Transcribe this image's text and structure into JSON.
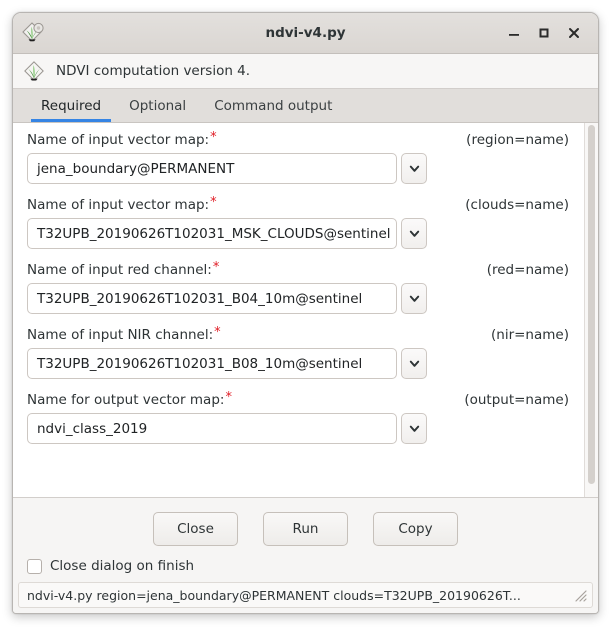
{
  "window": {
    "title": "ndvi-v4.py",
    "icon": "grass-gis-icon",
    "controls": {
      "minimize": "minimize-icon",
      "maximize": "maximize-icon",
      "close": "close-icon"
    }
  },
  "description": {
    "icon": "grass-gis-icon",
    "text": "NDVI computation version 4."
  },
  "tabs": [
    {
      "label": "Required",
      "active": true
    },
    {
      "label": "Optional",
      "active": false
    },
    {
      "label": "Command output",
      "active": false
    }
  ],
  "fields": [
    {
      "label": "Name of input vector map:",
      "required": "*",
      "key": "(region=name)",
      "value": "jena_boundary@PERMANENT",
      "placeholder": ""
    },
    {
      "label": "Name of input vector map:",
      "required": "*",
      "key": "(clouds=name)",
      "value": "T32UPB_20190626T102031_MSK_CLOUDS@sentinel",
      "placeholder": ""
    },
    {
      "label": "Name of input red channel:",
      "required": "*",
      "key": "(red=name)",
      "value": "T32UPB_20190626T102031_B04_10m@sentinel",
      "placeholder": ""
    },
    {
      "label": "Name of input NIR channel:",
      "required": "*",
      "key": "(nir=name)",
      "value": "T32UPB_20190626T102031_B08_10m@sentinel",
      "placeholder": ""
    },
    {
      "label": "Name for output vector map:",
      "required": "*",
      "key": "(output=name)",
      "value": "ndvi_class_2019",
      "placeholder": ""
    }
  ],
  "buttons": [
    {
      "label": "Close"
    },
    {
      "label": "Run"
    },
    {
      "label": "Copy"
    }
  ],
  "checkbox": {
    "label": "Close dialog on finish",
    "checked": false
  },
  "statusbar": {
    "text": "ndvi-v4.py region=jena_boundary@PERMANENT clouds=T32UPB_20190626T...",
    "grip": "resize-grip-icon"
  },
  "colors": {
    "accent": "#3584e4",
    "required_star": "#e01b24",
    "titlebar": "#ddd9d6",
    "content_bg": "#ffffff",
    "chrome_bg": "#f6f5f4"
  }
}
